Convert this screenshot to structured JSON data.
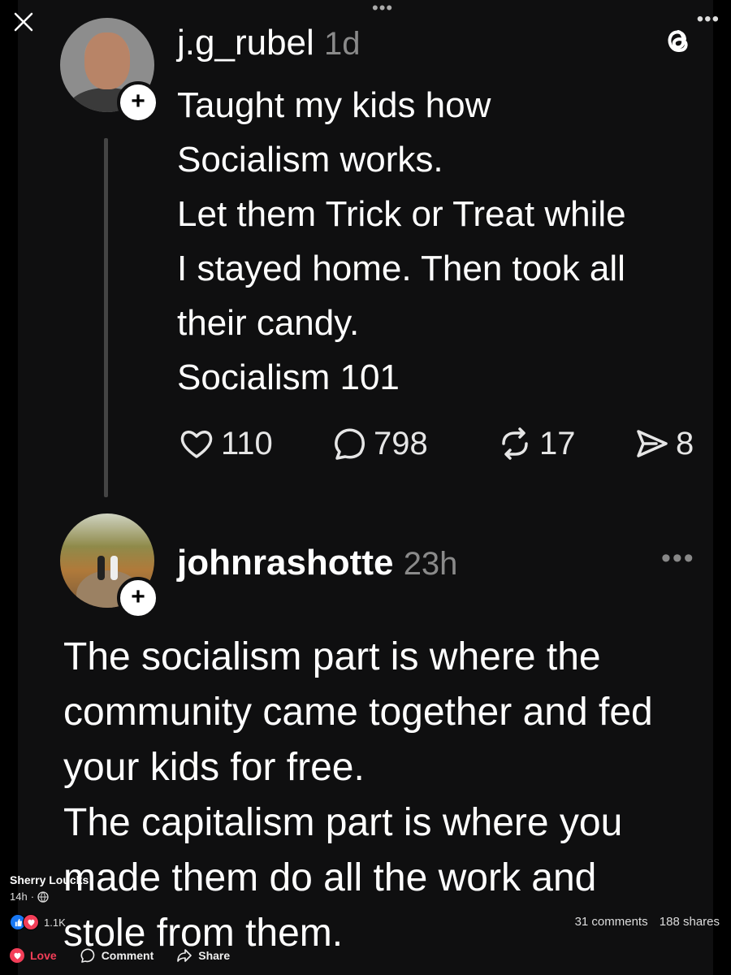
{
  "threads": {
    "post1": {
      "username": "j.g_rubel",
      "time": "1d",
      "lines": [
        "Taught my kids how",
        "Socialism works.",
        "Let them Trick or Treat while",
        "I stayed home. Then took all",
        "their candy.",
        "Socialism 101"
      ],
      "likes": "110",
      "comments": "798",
      "reposts": "17",
      "shares": "8"
    },
    "post2": {
      "username": "johnrashotte",
      "time": "23h",
      "lines": [
        "The socialism part is where the",
        "community came together and fed",
        "your kids for free.",
        "The capitalism part is where you",
        "made them do all the work and",
        "stole from them."
      ]
    },
    "follow_symbol": "+"
  },
  "facebook": {
    "author": "Sherry Loucks",
    "time": "14h",
    "reaction_count": "1.1K",
    "comments": "31 comments",
    "shares": "188 shares",
    "love_label": "Love",
    "comment_label": "Comment",
    "share_label": "Share"
  },
  "colors": {
    "background": "#000000",
    "card": "#0f0f10",
    "muted": "#8a8a8a",
    "love": "#f33e58",
    "like": "#1877f2"
  }
}
